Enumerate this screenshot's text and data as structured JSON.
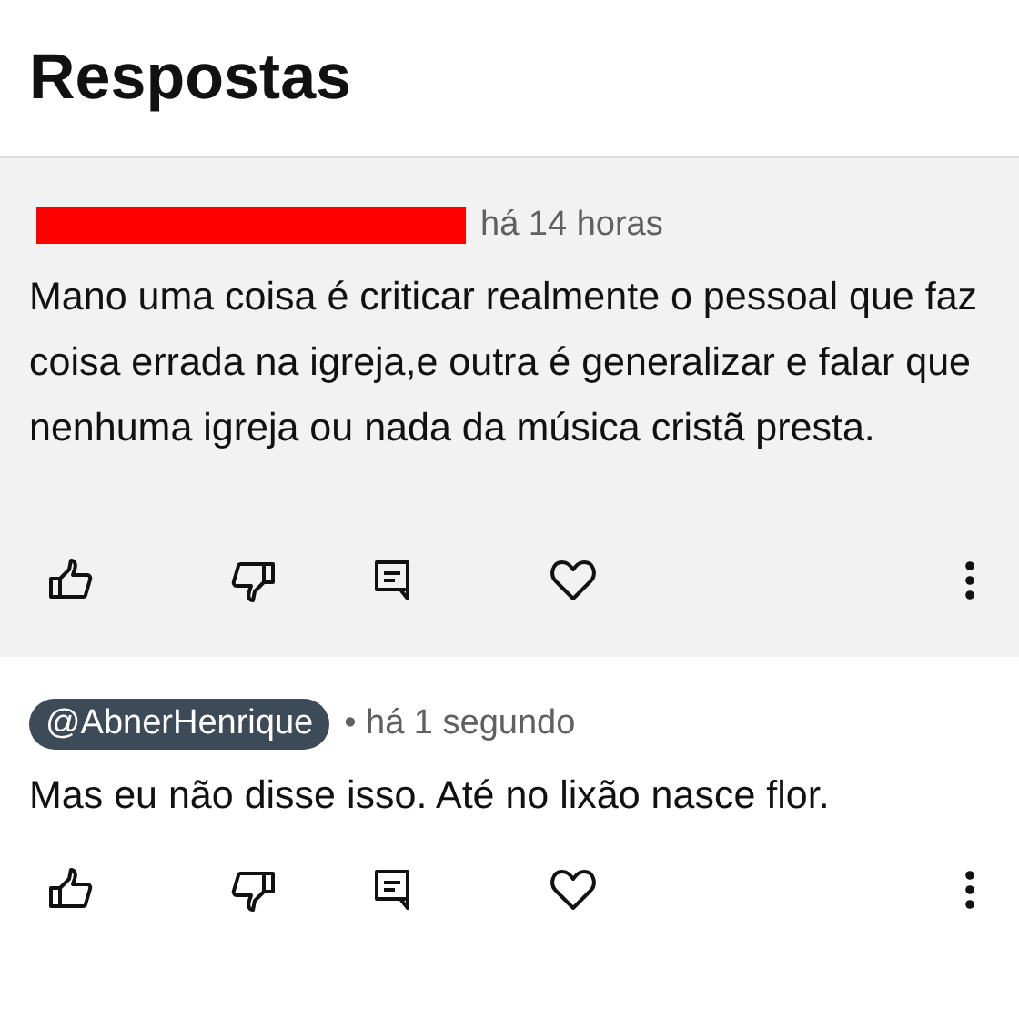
{
  "title": "Respostas",
  "comments": [
    {
      "kind": "parent",
      "redacted": true,
      "time": "há 14 horas",
      "text": "Mano uma coisa é criticar realmente o pessoal que faz coisa errada na igreja,e outra é generalizar e falar que nenhuma igreja ou nada da música cristã presta."
    },
    {
      "kind": "reply",
      "redacted": false,
      "author": "@AbnerHenrique",
      "time": "• há 1 segundo",
      "text": "Mas eu não disse isso. Até no lixão nasce flor."
    }
  ]
}
